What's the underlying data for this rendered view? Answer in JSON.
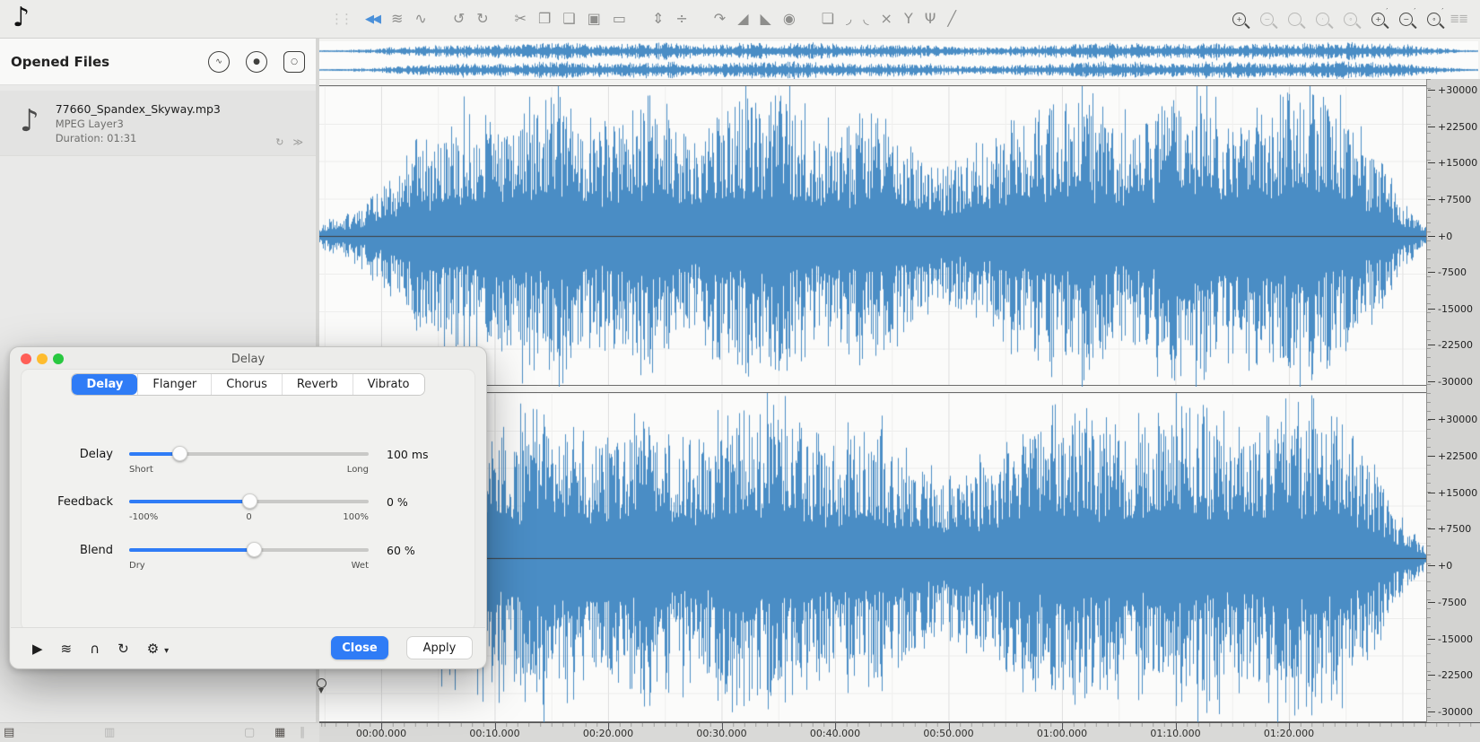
{
  "app": {
    "logo_glyph": "♪"
  },
  "toolbar": {
    "items": [
      {
        "name": "drag-handle-icon",
        "glyph": "⋮⋮",
        "style": "handle"
      },
      {
        "name": "skip-to-start-icon",
        "glyph": "◀◀",
        "style": "accent"
      },
      {
        "name": "waveform-view-icon",
        "glyph": "≋",
        "style": ""
      },
      {
        "name": "spectral-view-icon",
        "glyph": "∿",
        "style": ""
      },
      {
        "name": "undo-icon",
        "glyph": "↺",
        "style": "gap"
      },
      {
        "name": "redo-icon",
        "glyph": "↻",
        "style": ""
      },
      {
        "name": "cut-icon",
        "glyph": "✂",
        "style": "gap"
      },
      {
        "name": "copy-icon",
        "glyph": "❐",
        "style": ""
      },
      {
        "name": "paste-icon",
        "glyph": "❑",
        "style": ""
      },
      {
        "name": "paste-special-icon",
        "glyph": "▣",
        "style": ""
      },
      {
        "name": "crop-icon",
        "glyph": "▭",
        "style": ""
      },
      {
        "name": "trim-silence-icon",
        "glyph": "⇕",
        "style": "gap"
      },
      {
        "name": "split-icon",
        "glyph": "÷",
        "style": ""
      },
      {
        "name": "loop-region-icon",
        "glyph": "↷",
        "style": "gap"
      },
      {
        "name": "fade-in-icon",
        "glyph": "◢",
        "style": ""
      },
      {
        "name": "fade-out-icon",
        "glyph": "◣",
        "style": ""
      },
      {
        "name": "normalize-icon",
        "glyph": "◉",
        "style": ""
      },
      {
        "name": "layers-icon",
        "glyph": "❏",
        "style": "gap"
      },
      {
        "name": "curve-convex-icon",
        "glyph": "◞",
        "style": ""
      },
      {
        "name": "curve-concave-icon",
        "glyph": "◟",
        "style": ""
      },
      {
        "name": "curve-cross-icon",
        "glyph": "×",
        "style": ""
      },
      {
        "name": "curve-split-icon",
        "glyph": "Y",
        "style": ""
      },
      {
        "name": "curve-merge-icon",
        "glyph": "Ψ",
        "style": ""
      },
      {
        "name": "curve-linear-icon",
        "glyph": "╱",
        "style": ""
      }
    ],
    "zoom_items": [
      {
        "name": "zoom-in-icon",
        "sign": "+",
        "state": "active"
      },
      {
        "name": "zoom-out-icon",
        "sign": "−",
        "state": "disabled"
      },
      {
        "name": "zoom-selection-icon",
        "sign": "",
        "state": "disabled"
      },
      {
        "name": "zoom-vertical-icon",
        "sign": "·",
        "state": "disabled"
      },
      {
        "name": "zoom-full-icon",
        "sign": "∘",
        "state": "disabled"
      },
      {
        "name": "vertical-zoom-in-icon",
        "sign": "+",
        "state": "active-mark"
      },
      {
        "name": "vertical-zoom-out-icon",
        "sign": "−",
        "state": "active-mark"
      },
      {
        "name": "vertical-zoom-reset-icon",
        "sign": "∘",
        "state": "active-mark"
      }
    ],
    "list_glyph": "≣≣"
  },
  "sidebar": {
    "header": {
      "title": "Opened Files",
      "buttons": [
        {
          "name": "monitor-button",
          "glyph": "∿",
          "shape": "circle"
        },
        {
          "name": "record-button",
          "glyph": "●",
          "shape": "circle"
        },
        {
          "name": "duplicate-button",
          "glyph": "○",
          "shape": "square"
        }
      ]
    },
    "file": {
      "icon_glyph": "♪",
      "name": "77660_Spandex_Skyway.mp3",
      "format": "MPEG Layer3",
      "duration": "Duration: 01:31",
      "buttons": [
        {
          "name": "loop-playback-icon",
          "glyph": "↻"
        },
        {
          "name": "output-device-icon",
          "glyph": "≫"
        }
      ]
    }
  },
  "dialog": {
    "window_title": "Delay",
    "tabs": [
      "Delay",
      "Flanger",
      "Chorus",
      "Reverb",
      "Vibrato"
    ],
    "active_tab": 0,
    "sliders": [
      {
        "label": "Delay",
        "value": "100 ms",
        "position": 0.21,
        "ticks": [
          {
            "text": "Short",
            "pos": "left"
          },
          {
            "text": "Long",
            "pos": "right"
          }
        ]
      },
      {
        "label": "Feedback",
        "value": "0 %",
        "position": 0.5,
        "ticks": [
          {
            "text": "-100%",
            "pos": "left"
          },
          {
            "text": "0",
            "pos": "center"
          },
          {
            "text": "100%",
            "pos": "right"
          }
        ]
      },
      {
        "label": "Blend",
        "value": "60 %",
        "position": 0.52,
        "ticks": [
          {
            "text": "Dry",
            "pos": "left"
          },
          {
            "text": "Wet",
            "pos": "right"
          }
        ]
      }
    ],
    "footer": {
      "icons": [
        {
          "name": "preview-play-icon",
          "glyph": "▶",
          "cls": ""
        },
        {
          "name": "preview-waveform-icon",
          "glyph": "≋",
          "cls": ""
        },
        {
          "name": "preview-monitor-icon",
          "glyph": "∩",
          "cls": ""
        },
        {
          "name": "preview-loop-icon",
          "glyph": "↻",
          "cls": ""
        },
        {
          "name": "settings-gear-icon",
          "glyph": "⚙",
          "cls": ""
        },
        {
          "name": "settings-caret-icon",
          "glyph": "▾",
          "cls": "caret"
        }
      ],
      "close_label": "Close",
      "apply_label": "Apply"
    }
  },
  "waveform": {
    "color": "#4a8dc5",
    "centerline_color": "#3e3e3e",
    "channels": 2,
    "scale_labels": [
      "+30000",
      "+22500",
      "+15000",
      "+7500",
      "+0",
      "-7500",
      "-15000",
      "-22500",
      "-30000"
    ],
    "envelope": [
      0.07,
      0.1,
      0.18,
      0.32,
      0.45,
      0.52,
      0.58,
      0.62,
      0.55,
      0.68,
      0.74,
      0.6,
      0.55,
      0.66,
      0.72,
      0.58,
      0.52,
      0.62,
      0.68,
      0.72,
      0.66,
      0.58,
      0.52,
      0.6,
      0.55,
      0.48,
      0.4,
      0.36,
      0.42,
      0.52,
      0.6,
      0.66,
      0.7,
      0.64,
      0.58,
      0.62,
      0.68,
      0.72,
      0.66,
      0.6,
      0.64,
      0.7,
      0.74,
      0.68,
      0.55,
      0.38,
      0.18,
      0.05
    ]
  },
  "timeline": {
    "labels": [
      "00:00.000",
      "00:10.000",
      "00:20.000",
      "00:30.000",
      "00:40.000",
      "00:50.000",
      "01:00.000",
      "01:10.000",
      "01:20.000"
    ]
  },
  "statusbar": {
    "items": [
      {
        "name": "events-list-icon",
        "glyph": "▤",
        "dim": false
      },
      {
        "name": "blocks-icon",
        "glyph": "▥",
        "dim": true
      },
      {
        "name": "document-icon",
        "glyph": "▢",
        "dim": true
      },
      {
        "name": "grid-icon",
        "glyph": "▦",
        "dim": false
      },
      {
        "name": "pane-splitter-icon",
        "glyph": "∥",
        "dim": true
      }
    ]
  }
}
